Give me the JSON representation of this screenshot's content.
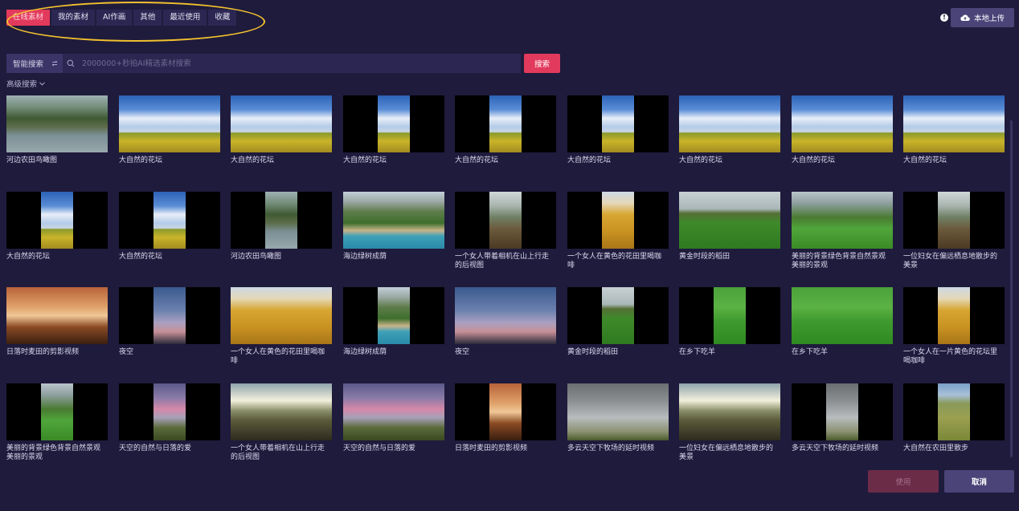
{
  "tabs": [
    {
      "label": "在线素材",
      "active": true
    },
    {
      "label": "我的素材",
      "active": false
    },
    {
      "label": "AI作画",
      "active": false
    },
    {
      "label": "其他",
      "active": false
    },
    {
      "label": "最近使用",
      "active": false
    },
    {
      "label": "收藏",
      "active": false
    }
  ],
  "upload": {
    "label": "本地上传",
    "icon": "cloud-upload-icon"
  },
  "search": {
    "mode_label": "智能搜索",
    "placeholder": "2000000+秒拍AI精选素材搜索",
    "button_label": "搜索"
  },
  "advanced_label": "高级搜索",
  "items": [
    {
      "caption": "河边农田鸟瞰图",
      "scene": "river",
      "format": "wide"
    },
    {
      "caption": "大自然的花坛",
      "scene": "sky-field",
      "format": "wide"
    },
    {
      "caption": "大自然的花坛",
      "scene": "sky-field",
      "format": "wide"
    },
    {
      "caption": "大自然的花坛",
      "scene": "sky-field",
      "format": "tall"
    },
    {
      "caption": "大自然的花坛",
      "scene": "sky-field",
      "format": "tall"
    },
    {
      "caption": "大自然的花坛",
      "scene": "sky-field",
      "format": "tall"
    },
    {
      "caption": "大自然的花坛",
      "scene": "sky-field",
      "format": "wide"
    },
    {
      "caption": "大自然的花坛",
      "scene": "sky-field",
      "format": "wide"
    },
    {
      "caption": "大自然的花坛",
      "scene": "sky-field",
      "format": "wide"
    },
    {
      "caption": "大自然的花坛",
      "scene": "sky-field",
      "format": "tall"
    },
    {
      "caption": "大自然的花坛",
      "scene": "sky-field",
      "format": "tall"
    },
    {
      "caption": "河边农田鸟瞰图",
      "scene": "river",
      "format": "tall"
    },
    {
      "caption": "海边绿树成荫",
      "scene": "coast",
      "format": "wide"
    },
    {
      "caption": "一个女人带着相机在山上行走的后视图",
      "scene": "mountain-walk",
      "format": "tall"
    },
    {
      "caption": "一个女人在黄色的花田里喝咖啡",
      "scene": "woman-field",
      "format": "tall"
    },
    {
      "caption": "黄金时段的稻田",
      "scene": "green-field",
      "format": "wide"
    },
    {
      "caption": "美丽的背景绿色背景自然景观美丽的景观",
      "scene": "green-tree",
      "format": "wide"
    },
    {
      "caption": "一位妇女在偏远栖息地散步的美景",
      "scene": "mountain-walk",
      "format": "tall"
    },
    {
      "caption": "日落时麦田的剪影视频",
      "scene": "sunset",
      "format": "wide"
    },
    {
      "caption": "夜空",
      "scene": "night-sky",
      "format": "tall"
    },
    {
      "caption": "一个女人在黄色的花田里喝咖啡",
      "scene": "woman-field",
      "format": "wide"
    },
    {
      "caption": "海边绿树成荫",
      "scene": "coast",
      "format": "tall"
    },
    {
      "caption": "夜空",
      "scene": "night-sky",
      "format": "wide"
    },
    {
      "caption": "黄金时段的稻田",
      "scene": "green-field",
      "format": "tall"
    },
    {
      "caption": "在乡下吃羊",
      "scene": "sheep",
      "format": "tall"
    },
    {
      "caption": "在乡下吃羊",
      "scene": "sheep",
      "format": "wide"
    },
    {
      "caption": "一个女人在一片黄色的花坛里喝咖啡",
      "scene": "woman-field",
      "format": "tall"
    },
    {
      "caption": "美丽的背景绿色背景自然景观美丽的景观",
      "scene": "green-tree",
      "format": "tall"
    },
    {
      "caption": "天空的自然与日落的爱",
      "scene": "pink-sky",
      "format": "tall"
    },
    {
      "caption": "一个女人带着相机在山上行走的后视图",
      "scene": "sun-mountain",
      "format": "wide"
    },
    {
      "caption": "天空的自然与日落的爱",
      "scene": "pink-sky",
      "format": "wide"
    },
    {
      "caption": "日落时麦田的剪影视频",
      "scene": "sunset",
      "format": "tall"
    },
    {
      "caption": "多云天空下牧场的延时视频",
      "scene": "cloudy",
      "format": "wide"
    },
    {
      "caption": "一位妇女在偏远栖息地散步的美景",
      "scene": "sun-mountain",
      "format": "wide"
    },
    {
      "caption": "多云天空下牧场的延时视频",
      "scene": "cloudy",
      "format": "tall"
    },
    {
      "caption": "大自然在农田里散步",
      "scene": "farm",
      "format": "tall"
    }
  ],
  "footer": {
    "use_label": "使用",
    "cancel_label": "取消"
  }
}
